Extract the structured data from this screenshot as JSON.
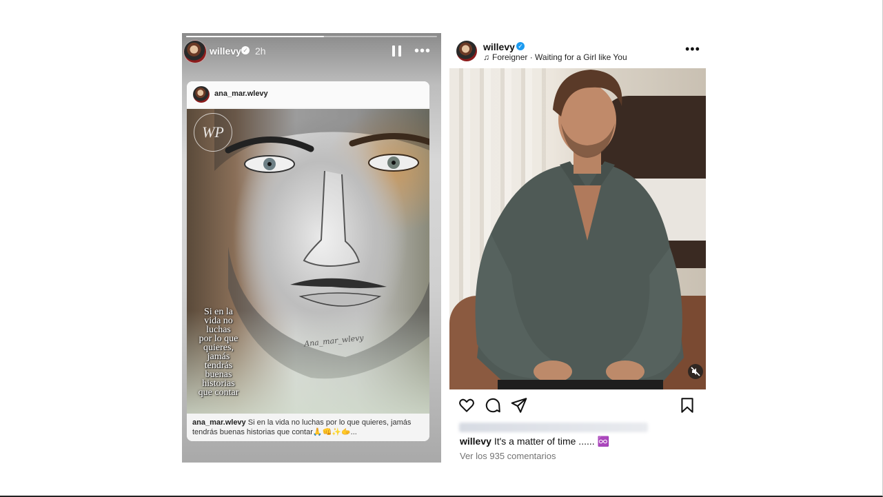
{
  "story": {
    "username": "willevy",
    "verified_mark": "✓",
    "time": "2h",
    "progress": 0.55,
    "pause_icon": "pause-icon",
    "more_icon": "more-horizontal-icon",
    "repost": {
      "username": "ana_mar.wlevy",
      "logo_text": "WP",
      "quote_lines": [
        "Si en la",
        "vida no",
        "luchas",
        "por lo que",
        "quieres,",
        "jamás",
        "tendrás",
        "buenas",
        "historias",
        "que contar"
      ],
      "signature": "Ana_mar_wlevy",
      "caption_user": "ana_mar.wlevy",
      "caption_text": "Si en la vida no luchas por lo que quieres, jamás tendrás buenas historias que contar🙏👊✨🫱..."
    }
  },
  "post": {
    "username": "willevy",
    "verified_mark": "✓",
    "music_icon": "♫",
    "audio_text": "Foreigner · Waiting for a Girl like You",
    "more_glyph": "•••",
    "caption_user": "willevy",
    "caption_text": "It's a matter of time ...... ♾️",
    "comments_text": "Ver los 935 comentarios",
    "icons": [
      "heart-icon",
      "comment-icon",
      "share-icon",
      "bookmark-icon",
      "muted-audio-icon"
    ]
  },
  "colors": {
    "verified_blue": "#1d9bf0",
    "muted_text": "#737373"
  }
}
